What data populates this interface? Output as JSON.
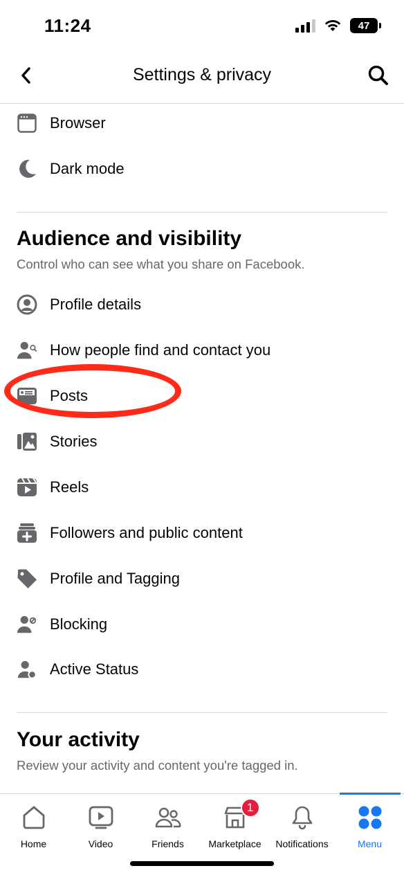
{
  "status_bar": {
    "time": "11:24",
    "battery": "47"
  },
  "header": {
    "title": "Settings & privacy"
  },
  "preferences": {
    "items": [
      {
        "label": "Browser",
        "icon": "browser-icon"
      },
      {
        "label": "Dark mode",
        "icon": "moon-icon"
      }
    ]
  },
  "audience": {
    "title": "Audience and visibility",
    "subtitle": "Control who can see what you share on Facebook.",
    "items": [
      {
        "label": "Profile details",
        "icon": "profile-circle-icon"
      },
      {
        "label": "How people find and contact you",
        "icon": "person-search-icon"
      },
      {
        "label": "Posts",
        "icon": "post-card-icon"
      },
      {
        "label": "Stories",
        "icon": "stories-icon"
      },
      {
        "label": "Reels",
        "icon": "reels-icon"
      },
      {
        "label": "Followers and public content",
        "icon": "followers-icon"
      },
      {
        "label": "Profile and Tagging",
        "icon": "tag-icon"
      },
      {
        "label": "Blocking",
        "icon": "person-block-icon"
      },
      {
        "label": "Active Status",
        "icon": "active-status-icon"
      }
    ]
  },
  "activity": {
    "title": "Your activity",
    "subtitle": "Review your activity and content you're tagged in."
  },
  "bottom_nav": {
    "items": [
      {
        "label": "Home",
        "icon": "home-icon"
      },
      {
        "label": "Video",
        "icon": "video-icon"
      },
      {
        "label": "Friends",
        "icon": "friends-icon"
      },
      {
        "label": "Marketplace",
        "icon": "marketplace-icon",
        "badge": "1"
      },
      {
        "label": "Notifications",
        "icon": "bell-icon"
      },
      {
        "label": "Menu",
        "icon": "menu-grid-icon",
        "active": true
      }
    ]
  },
  "colors": {
    "accent": "#1877f2",
    "icon_gray": "#65676b",
    "badge": "#e41e3f",
    "annotation": "#ff2a17"
  }
}
